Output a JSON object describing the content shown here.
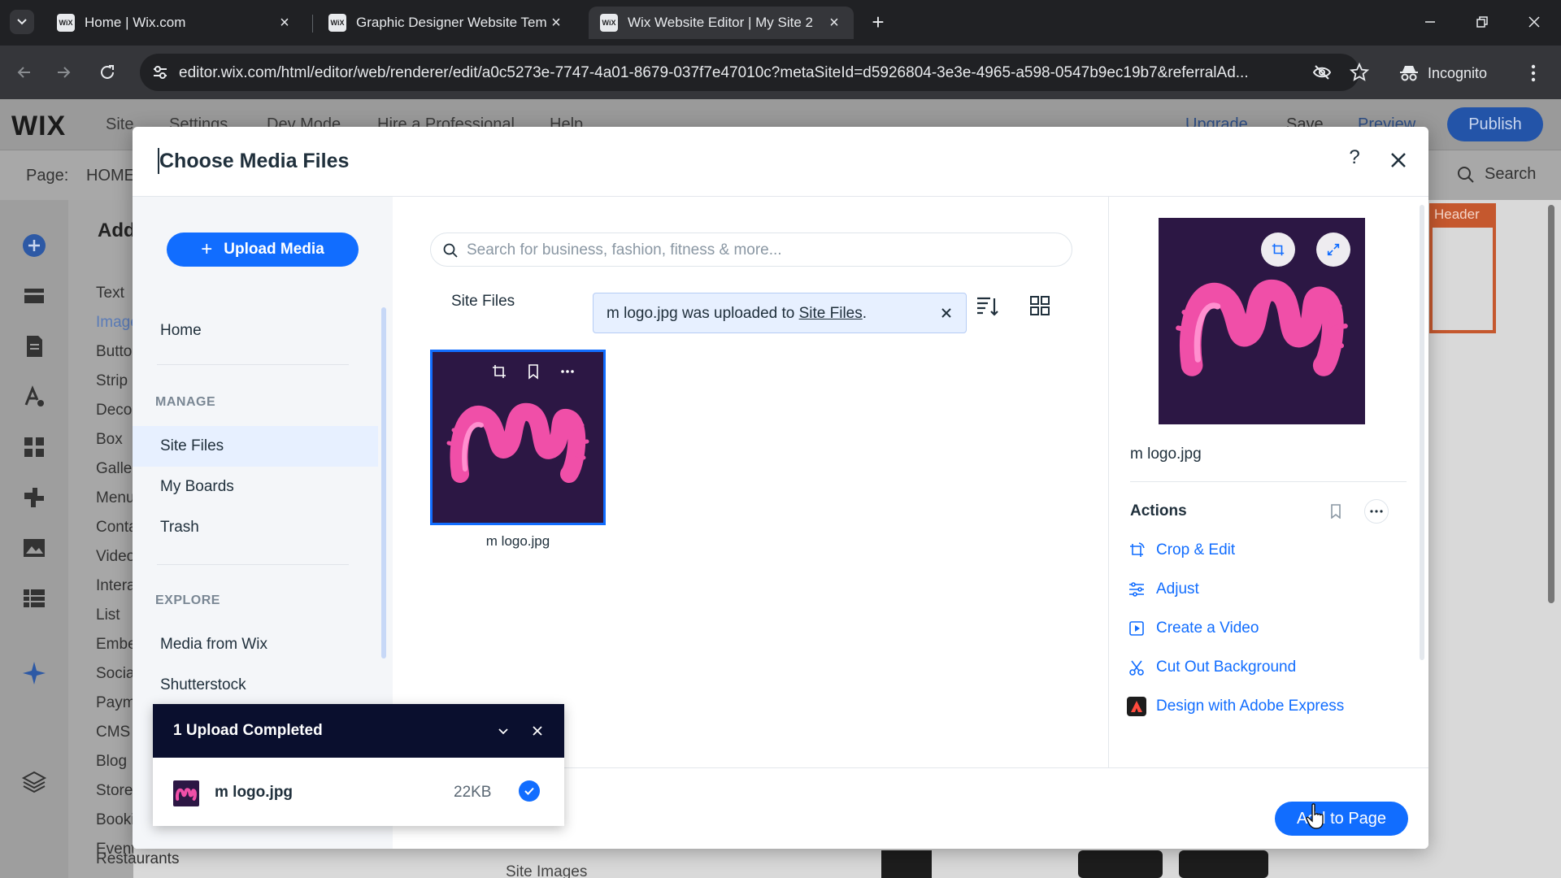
{
  "browser": {
    "tabs": [
      {
        "title": "Home | Wix.com",
        "favicon": "WiX",
        "active": false
      },
      {
        "title": "Graphic Designer Website Tem",
        "favicon": "WiX",
        "active": false
      },
      {
        "title": "Wix Website Editor | My Site 2",
        "favicon": "WiX",
        "active": true
      }
    ],
    "url": "editor.wix.com/html/editor/web/renderer/edit/a0c5273e-7747-4a01-8679-037f7e47010c?metaSiteId=d5926804-3e3e-4965-a598-0547b9ec19b7&referralAd...",
    "incognito_label": "Incognito"
  },
  "editor": {
    "logo": "WIX",
    "menu": [
      "Site",
      "Settings",
      "Dev Mode",
      "Hire a Professional",
      "Help"
    ],
    "right_menu": [
      "Upgrade",
      "Save",
      "Preview"
    ],
    "publish_label": "Publish",
    "page_label": "Page:",
    "page_name": "HOME",
    "search_label": "Search",
    "add_title": "Add",
    "add_items": [
      "Text",
      "Image",
      "Button",
      "Strip",
      "Decorative",
      "Box",
      "Gallery",
      "Menu",
      "Contact",
      "Video",
      "Interactive",
      "List",
      "Embed",
      "Social",
      "Payments",
      "CMS",
      "Blog",
      "Store",
      "Bookings",
      "Events"
    ],
    "restaurants_label": "Restaurants",
    "header_tag": "Header",
    "site_images_label": "Site Images"
  },
  "modal": {
    "title": "Choose Media Files",
    "help_label": "?",
    "upload_button": "Upload Media",
    "nav_home": "Home",
    "section_manage": "MANAGE",
    "manage_items": [
      "Site Files",
      "My Boards",
      "Trash"
    ],
    "section_explore": "EXPLORE",
    "explore_items": [
      "Media from Wix",
      "Shutterstock"
    ],
    "search_placeholder": "Search for business, fashion, fitness & more...",
    "folder_title": "Site Files",
    "toast": {
      "prefix": "m logo.jpg was uploaded to ",
      "link": "Site Files",
      "suffix": "."
    },
    "file": {
      "name": "m logo.jpg"
    },
    "details": {
      "file_name": "m logo.jpg",
      "actions_title": "Actions",
      "actions": [
        {
          "label": "Crop & Edit",
          "icon": "crop-rotate-icon"
        },
        {
          "label": "Adjust",
          "icon": "sliders-icon"
        },
        {
          "label": "Create a Video",
          "icon": "video-icon"
        },
        {
          "label": "Cut Out Background",
          "icon": "scissors-icon"
        },
        {
          "label": "Design with Adobe Express",
          "icon": "adobe-express-icon"
        }
      ]
    },
    "add_to_page": "Add to Page"
  },
  "upload_popup": {
    "title": "1 Upload Completed",
    "file_name": "m logo.jpg",
    "file_size": "22KB",
    "status": "completed"
  },
  "colors": {
    "accent": "#116dff",
    "logo_bg": "#2c1744",
    "logo_pink": "#f04fa8",
    "popup_header": "#0a0f2e"
  }
}
